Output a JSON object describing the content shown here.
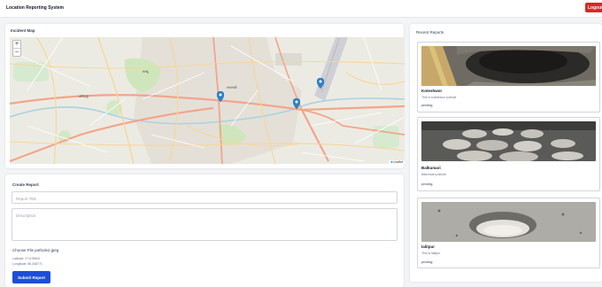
{
  "header": {
    "title": "Location Reporting System",
    "logout_label": "Logout"
  },
  "map": {
    "title": "Incident Map",
    "zoom_in": "+",
    "zoom_out": "−",
    "attribution": "Leaflet",
    "marker_count": 3
  },
  "create_report": {
    "title": "Create Report",
    "title_placeholder": "Report Title",
    "description_placeholder": "Description",
    "file_text": "Choose File pothole2.jpeg",
    "latitude_text": "Latitude: 27.678604",
    "longitude_text": "Longitude: 85.348771",
    "submit_label": "Submit Report"
  },
  "recent_reports": {
    "title": "Recent Reports",
    "items": [
      {
        "title": "Koteshwor",
        "description": "This is koteshwor pothole",
        "status": "pending"
      },
      {
        "title": "Balkumari",
        "description": "Balkumari pothole",
        "status": "pending"
      },
      {
        "title": "lalitpur",
        "description": "This is lalitpur",
        "status": "pending"
      }
    ]
  },
  "colors": {
    "primary": "#1d4ed8",
    "danger": "#dc2626",
    "marker": "#2b82cb",
    "background": "#f3f4f6"
  }
}
